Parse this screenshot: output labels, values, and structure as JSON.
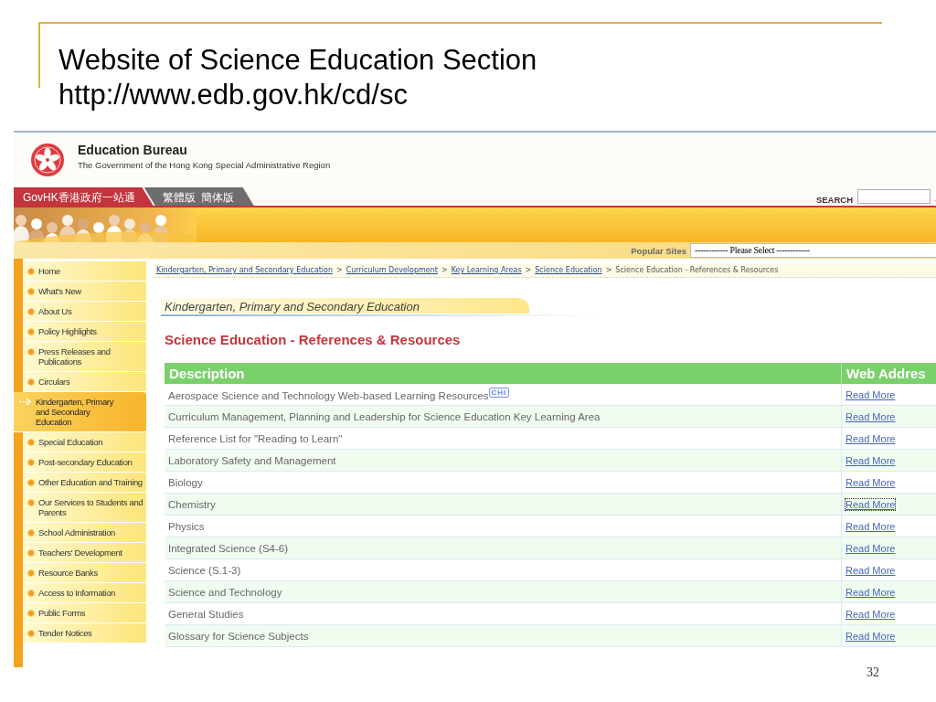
{
  "slide": {
    "title": "Website of Science Education Section",
    "subtitle": "http://www.edb.gov.hk/cd/sc",
    "page_number": "32"
  },
  "header": {
    "org_name": "Education Bureau",
    "org_subtitle": "The Government of the Hong Kong Special Administrative Region",
    "govhk_link": "GovHK香港政府一站通",
    "language_links": [
      "繁體版",
      "簡体版"
    ],
    "search_label": "SEARCH"
  },
  "popular_sites": {
    "label": "Popular Sites",
    "value": "------------ Please Select ------------"
  },
  "sidebar": {
    "items": [
      {
        "label": "Home",
        "selected": false
      },
      {
        "label": "What's New",
        "selected": false
      },
      {
        "label": "About Us",
        "selected": false
      },
      {
        "label": "Policy Highlights",
        "selected": false
      },
      {
        "label": "Press Releases and Publications",
        "selected": false
      },
      {
        "label": "Circulars",
        "selected": false
      },
      {
        "label": "Kindergarten, Primary and Secondary Education",
        "selected": true
      },
      {
        "label": "Special Education",
        "selected": false
      },
      {
        "label": "Post-secondary Education",
        "selected": false
      },
      {
        "label": "Other Education and Training",
        "selected": false
      },
      {
        "label": "Our Services to Students and Parents",
        "selected": false
      },
      {
        "label": "School Administration",
        "selected": false
      },
      {
        "label": "Teachers' Development",
        "selected": false
      },
      {
        "label": "Resource Banks",
        "selected": false
      },
      {
        "label": "Access to Information",
        "selected": false
      },
      {
        "label": "Public Forms",
        "selected": false
      },
      {
        "label": "Tender Notices",
        "selected": false
      }
    ]
  },
  "breadcrumb": [
    {
      "label": "Kindergarten, Primary and Secondary Education",
      "link": true
    },
    {
      "separator": ">",
      "label": "Curriculum Development",
      "link": true
    },
    {
      "separator": ">",
      "label": "Key Learning Areas",
      "link": true
    },
    {
      "separator": ">",
      "label": "Science Education",
      "link": true
    },
    {
      "separator": ">",
      "label": "Science Education - References & Resources",
      "link": false
    }
  ],
  "section_heading": "Kindergarten, Primary and Secondary Education",
  "page_title": "Science Education - References & Resources",
  "table": {
    "columns": [
      "Description",
      "Web Addres"
    ],
    "rows": [
      {
        "description": "Aerospace Science and Technology Web-based Learning Resources",
        "badge": "CHI",
        "link": "Read More",
        "focused": false
      },
      {
        "description": "Curriculum Management, Planning and Leadership for Science Education Key Learning Area",
        "link": "Read More",
        "focused": false
      },
      {
        "description": "Reference List for \"Reading to Learn\"",
        "link": "Read More",
        "focused": false
      },
      {
        "description": "Laboratory Safety and Management",
        "link": "Read More",
        "focused": false
      },
      {
        "description": "Biology",
        "link": "Read More",
        "focused": false
      },
      {
        "description": "Chemistry",
        "link": "Read More",
        "focused": true
      },
      {
        "description": "Physics",
        "link": "Read More",
        "focused": false
      },
      {
        "description": "Integrated Science (S4-6)",
        "link": "Read More",
        "focused": false
      },
      {
        "description": "Science (S.1-3)",
        "link": "Read More",
        "focused": false
      },
      {
        "description": "Science and Technology",
        "link": "Read More",
        "focused": false
      },
      {
        "description": "General Studies",
        "link": "Read More",
        "focused": false
      },
      {
        "description": "Glossary for Science Subjects",
        "link": "Read More",
        "focused": false
      }
    ]
  }
}
